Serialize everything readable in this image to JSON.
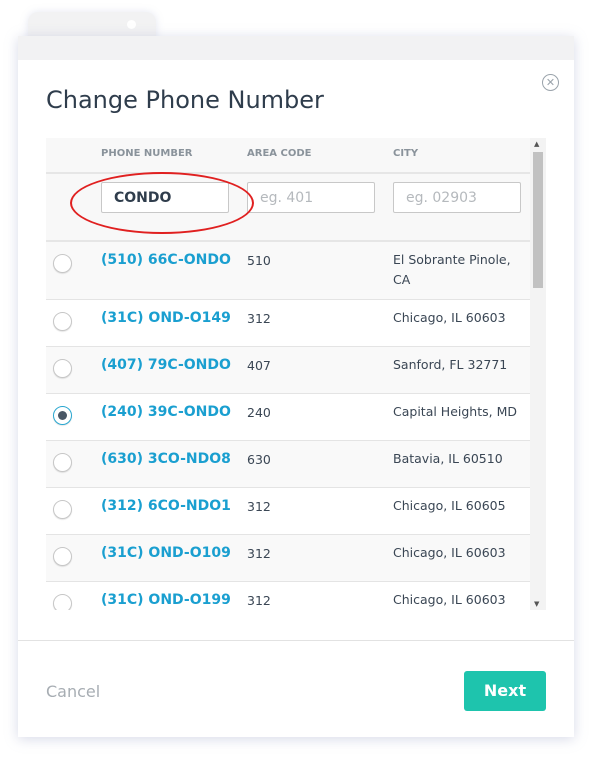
{
  "title": "Change Phone Number",
  "columns": {
    "phone": "PHONE NUMBER",
    "area": "AREA CODE",
    "city": "CITY"
  },
  "filters": {
    "phone_value": "CONDO",
    "area_placeholder": "eg. 401",
    "city_placeholder": "eg. 02903"
  },
  "rows": [
    {
      "phone": "(510) 66C-ONDO",
      "area": "510",
      "city": "El Sobrante Pinole, CA",
      "selected": false
    },
    {
      "phone": "(31C) OND-O149",
      "area": "312",
      "city": "Chicago, IL 60603",
      "selected": false
    },
    {
      "phone": "(407) 79C-ONDO",
      "area": "407",
      "city": "Sanford, FL 32771",
      "selected": false
    },
    {
      "phone": "(240) 39C-ONDO",
      "area": "240",
      "city": "Capital Heights, MD",
      "selected": true
    },
    {
      "phone": "(630) 3CO-NDO8",
      "area": "630",
      "city": "Batavia, IL 60510",
      "selected": false
    },
    {
      "phone": "(312) 6CO-NDO1",
      "area": "312",
      "city": "Chicago, IL 60605",
      "selected": false
    },
    {
      "phone": "(31C) OND-O109",
      "area": "312",
      "city": "Chicago, IL 60603",
      "selected": false
    },
    {
      "phone": "(31C) OND-O199",
      "area": "312",
      "city": "Chicago, IL 60603",
      "selected": false
    }
  ],
  "footer": {
    "cancel": "Cancel",
    "next": "Next"
  },
  "colors": {
    "accent": "#1ec4ad",
    "link": "#1a9fd0",
    "annotation": "#e02020"
  }
}
